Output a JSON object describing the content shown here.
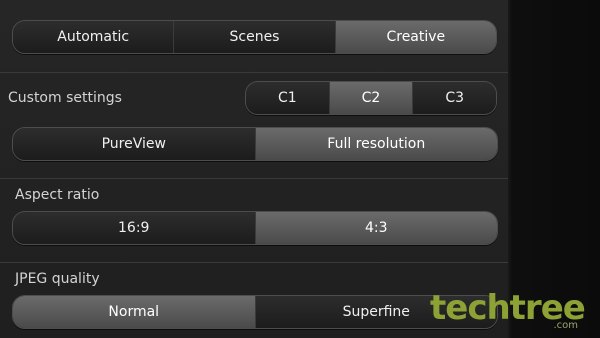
{
  "mode_tabs": {
    "items": [
      "Automatic",
      "Scenes",
      "Creative"
    ],
    "selected": 2
  },
  "custom_settings": {
    "label": "Custom settings",
    "items": [
      "C1",
      "C2",
      "C3"
    ],
    "selected": 1
  },
  "resolution": {
    "items": [
      "PureView",
      "Full resolution"
    ],
    "selected": 1
  },
  "aspect_ratio": {
    "label": "Aspect ratio",
    "items": [
      "16:9",
      "4:3"
    ],
    "selected": 1
  },
  "jpeg_quality": {
    "label": "JPEG quality",
    "items": [
      "Normal",
      "Superfine"
    ],
    "selected": 0
  },
  "watermark": {
    "brand": "techtree",
    "suffix": ".com",
    "color": "#8ca235"
  }
}
